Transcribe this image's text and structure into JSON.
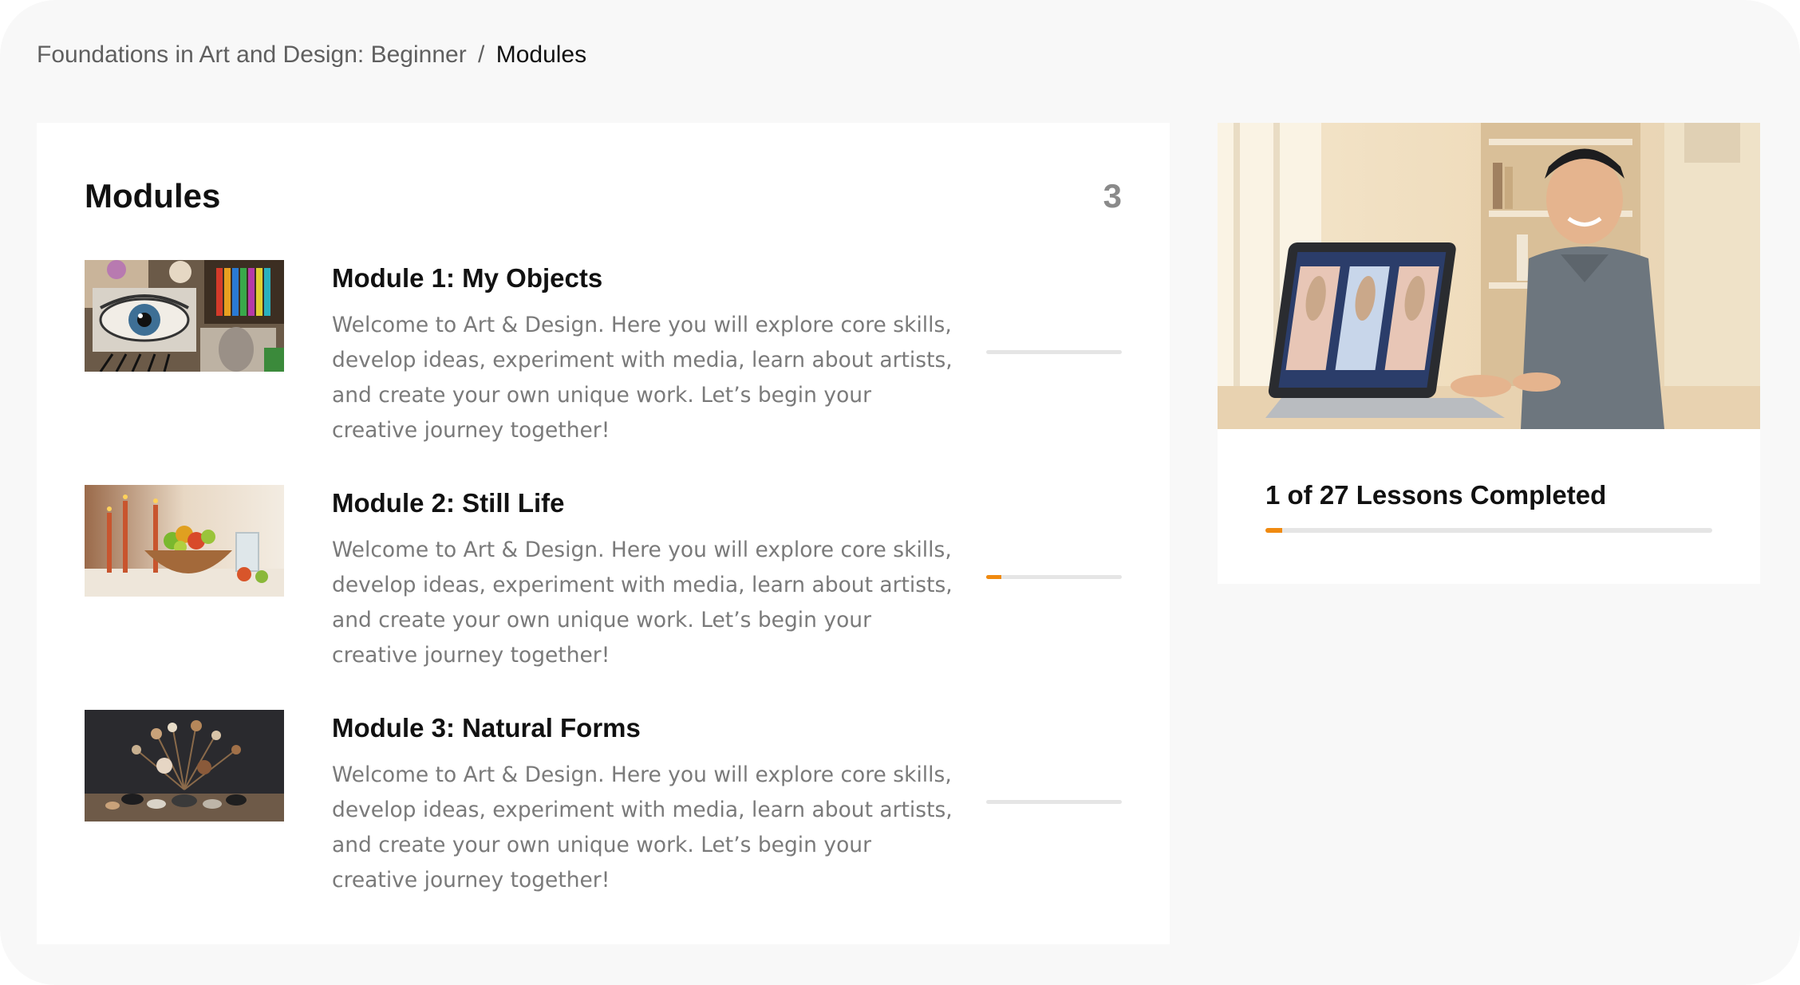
{
  "breadcrumb": {
    "course": "Foundations in Art and Design: Beginner",
    "separator": "/",
    "current": "Modules"
  },
  "modules_panel": {
    "title": "Modules",
    "count": "3",
    "items": [
      {
        "title": "Module 1: My Objects",
        "description": "Welcome to Art & Design. Here you will explore core skills, develop ideas, experiment with media, learn about artists, and create your own unique work. Let’s begin your creative journey together!",
        "progress": 0,
        "thumbnail": "art-collage-eye-image"
      },
      {
        "title": "Module 2: Still Life",
        "description": "Welcome to Art & Design. Here you will explore core skills, develop ideas, experiment with media, learn about artists, and create your own unique work. Let’s begin your creative journey together!",
        "progress": 0.11,
        "thumbnail": "still-life-fruit-candles-image"
      },
      {
        "title": "Module 3: Natural Forms",
        "description": "Welcome to Art & Design. Here you will explore core skills, develop ideas, experiment with media, learn about artists, and create your own unique work. Let’s begin your creative journey together!",
        "progress": 0,
        "thumbnail": "dried-flowers-stones-image"
      }
    ]
  },
  "summary": {
    "lessons_completed_text": "1 of 27 Lessons Completed",
    "progress": 0.037,
    "hero_image": "student-laptop-image"
  },
  "colors": {
    "accent": "#f08a10",
    "track": "#e5e5e5",
    "background": "#f8f8f8"
  }
}
